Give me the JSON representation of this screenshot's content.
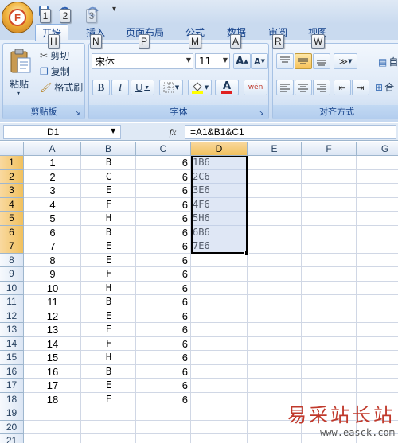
{
  "quick_access": {
    "office_button_letter": "F",
    "keytips": [
      "1",
      "2",
      "3"
    ]
  },
  "tabs": [
    {
      "label": "开始",
      "keytip": "H",
      "active": true
    },
    {
      "label": "插入",
      "keytip": "N",
      "active": false
    },
    {
      "label": "页面布局",
      "keytip": "P",
      "active": false
    },
    {
      "label": "公式",
      "keytip": "M",
      "active": false
    },
    {
      "label": "数据",
      "keytip": "A",
      "active": false
    },
    {
      "label": "审阅",
      "keytip": "R",
      "active": false
    },
    {
      "label": "视图",
      "keytip": "W",
      "active": false
    }
  ],
  "ribbon": {
    "clipboard": {
      "label": "剪贴板",
      "paste": "粘贴",
      "cut": "剪切",
      "copy": "复制",
      "format_painter": "格式刷"
    },
    "font": {
      "label": "字体",
      "font_name": "宋体",
      "font_size": "11",
      "grow": "A",
      "shrink": "A",
      "bold": "B",
      "italic": "I",
      "underline": "U",
      "font_color_letter": "A",
      "fill_color": "#ffff00",
      "font_color": "#e02020",
      "phonetic": "wén"
    },
    "alignment": {
      "label": "对齐方式",
      "wrap_fragment": "自",
      "merge_fragment": "合"
    }
  },
  "formula_bar": {
    "name_box": "D1",
    "fx": "fx",
    "formula": "=A1&B1&C1"
  },
  "sheet": {
    "columns": [
      "A",
      "B",
      "C",
      "D",
      "E",
      "F",
      "G"
    ],
    "selected_column": "D",
    "rows": [
      {
        "n": "1",
        "a": "1",
        "b": "B",
        "c": "6",
        "d": "1B6"
      },
      {
        "n": "2",
        "a": "2",
        "b": "C",
        "c": "6",
        "d": "2C6"
      },
      {
        "n": "3",
        "a": "3",
        "b": "E",
        "c": "6",
        "d": "3E6"
      },
      {
        "n": "4",
        "a": "4",
        "b": "F",
        "c": "6",
        "d": "4F6"
      },
      {
        "n": "5",
        "a": "5",
        "b": "H",
        "c": "6",
        "d": "5H6"
      },
      {
        "n": "6",
        "a": "6",
        "b": "B",
        "c": "6",
        "d": "6B6"
      },
      {
        "n": "7",
        "a": "7",
        "b": "E",
        "c": "6",
        "d": "7E6"
      },
      {
        "n": "8",
        "a": "8",
        "b": "E",
        "c": "6",
        "d": ""
      },
      {
        "n": "9",
        "a": "9",
        "b": "F",
        "c": "6",
        "d": ""
      },
      {
        "n": "10",
        "a": "10",
        "b": "H",
        "c": "6",
        "d": ""
      },
      {
        "n": "11",
        "a": "11",
        "b": "B",
        "c": "6",
        "d": ""
      },
      {
        "n": "12",
        "a": "12",
        "b": "E",
        "c": "6",
        "d": ""
      },
      {
        "n": "13",
        "a": "13",
        "b": "E",
        "c": "6",
        "d": ""
      },
      {
        "n": "14",
        "a": "14",
        "b": "F",
        "c": "6",
        "d": ""
      },
      {
        "n": "15",
        "a": "15",
        "b": "H",
        "c": "6",
        "d": ""
      },
      {
        "n": "16",
        "a": "16",
        "b": "B",
        "c": "6",
        "d": ""
      },
      {
        "n": "17",
        "a": "17",
        "b": "E",
        "c": "6",
        "d": ""
      },
      {
        "n": "18",
        "a": "18",
        "b": "E",
        "c": "6",
        "d": ""
      },
      {
        "n": "19",
        "a": "",
        "b": "",
        "c": "",
        "d": ""
      },
      {
        "n": "20",
        "a": "",
        "b": "",
        "c": "",
        "d": ""
      },
      {
        "n": "21",
        "a": "",
        "b": "",
        "c": "",
        "d": ""
      }
    ],
    "selected_rows": [
      "1",
      "2",
      "3",
      "4",
      "5",
      "6",
      "7"
    ]
  },
  "watermark": {
    "text": "易采站长站",
    "url": "www.easck.com"
  }
}
